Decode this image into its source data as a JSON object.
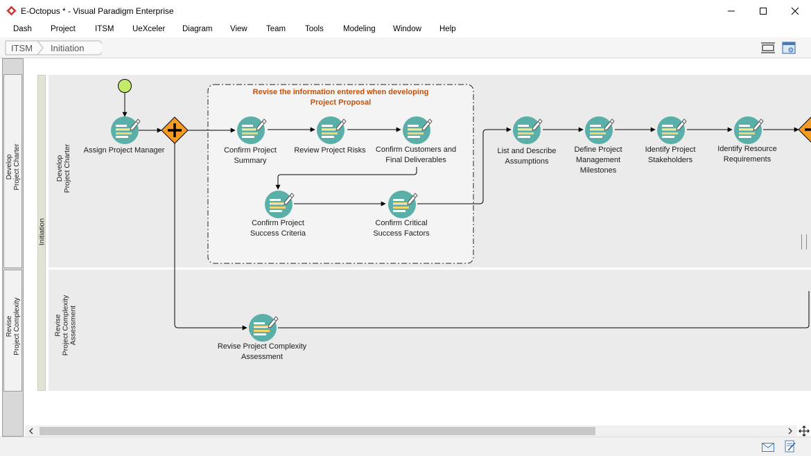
{
  "window": {
    "title": "E-Octopus * - Visual Paradigm Enterprise"
  },
  "menu": [
    "Dash",
    "Project",
    "ITSM",
    "UeXceler",
    "Diagram",
    "View",
    "Team",
    "Tools",
    "Modeling",
    "Window",
    "Help"
  ],
  "breadcrumb": [
    "ITSM",
    "Initiation"
  ],
  "pool": {
    "name": "Initiation"
  },
  "lanes": {
    "develop": {
      "header": [
        "Develop",
        "Project Charter"
      ]
    },
    "revise": {
      "header": [
        "Revise",
        "Project Complexity",
        "Assessment"
      ]
    }
  },
  "left_header": {
    "develop": [
      "Develop",
      "Project Charter"
    ],
    "revise": [
      "Revise",
      "Project Complexity"
    ]
  },
  "group": {
    "label": [
      "Revise the information entered when developing",
      "Project Proposal"
    ]
  },
  "tasks": {
    "assign_pm": [
      "Assign Project Manager"
    ],
    "confirm_summary": [
      "Confirm Project",
      "Summary"
    ],
    "review_risks": [
      "Review Project Risks"
    ],
    "confirm_customers": [
      "Confirm Customers and",
      "Final Deliverables"
    ],
    "confirm_success": [
      "Confirm Project",
      "Success Criteria"
    ],
    "confirm_csf": [
      "Confirm Critical",
      "Success Factors"
    ],
    "list_assumptions": [
      "List and Describe",
      "Assumptions"
    ],
    "define_milestones": [
      "Define Project",
      "Management",
      "Milestones"
    ],
    "identify_stakeholders": [
      "Identify Project",
      "Stakeholders"
    ],
    "identify_resources": [
      "Identify Resource",
      "Requirements"
    ],
    "revise_complexity": [
      "Revise Project Complexity",
      "Assessment"
    ]
  },
  "colors": {
    "task_teal": "#5aafa8",
    "gateway_orange": "#f59a23",
    "start_green": "#c3ea6a",
    "group_label": "#c0520b",
    "lane_bg": "#ebebeb"
  }
}
